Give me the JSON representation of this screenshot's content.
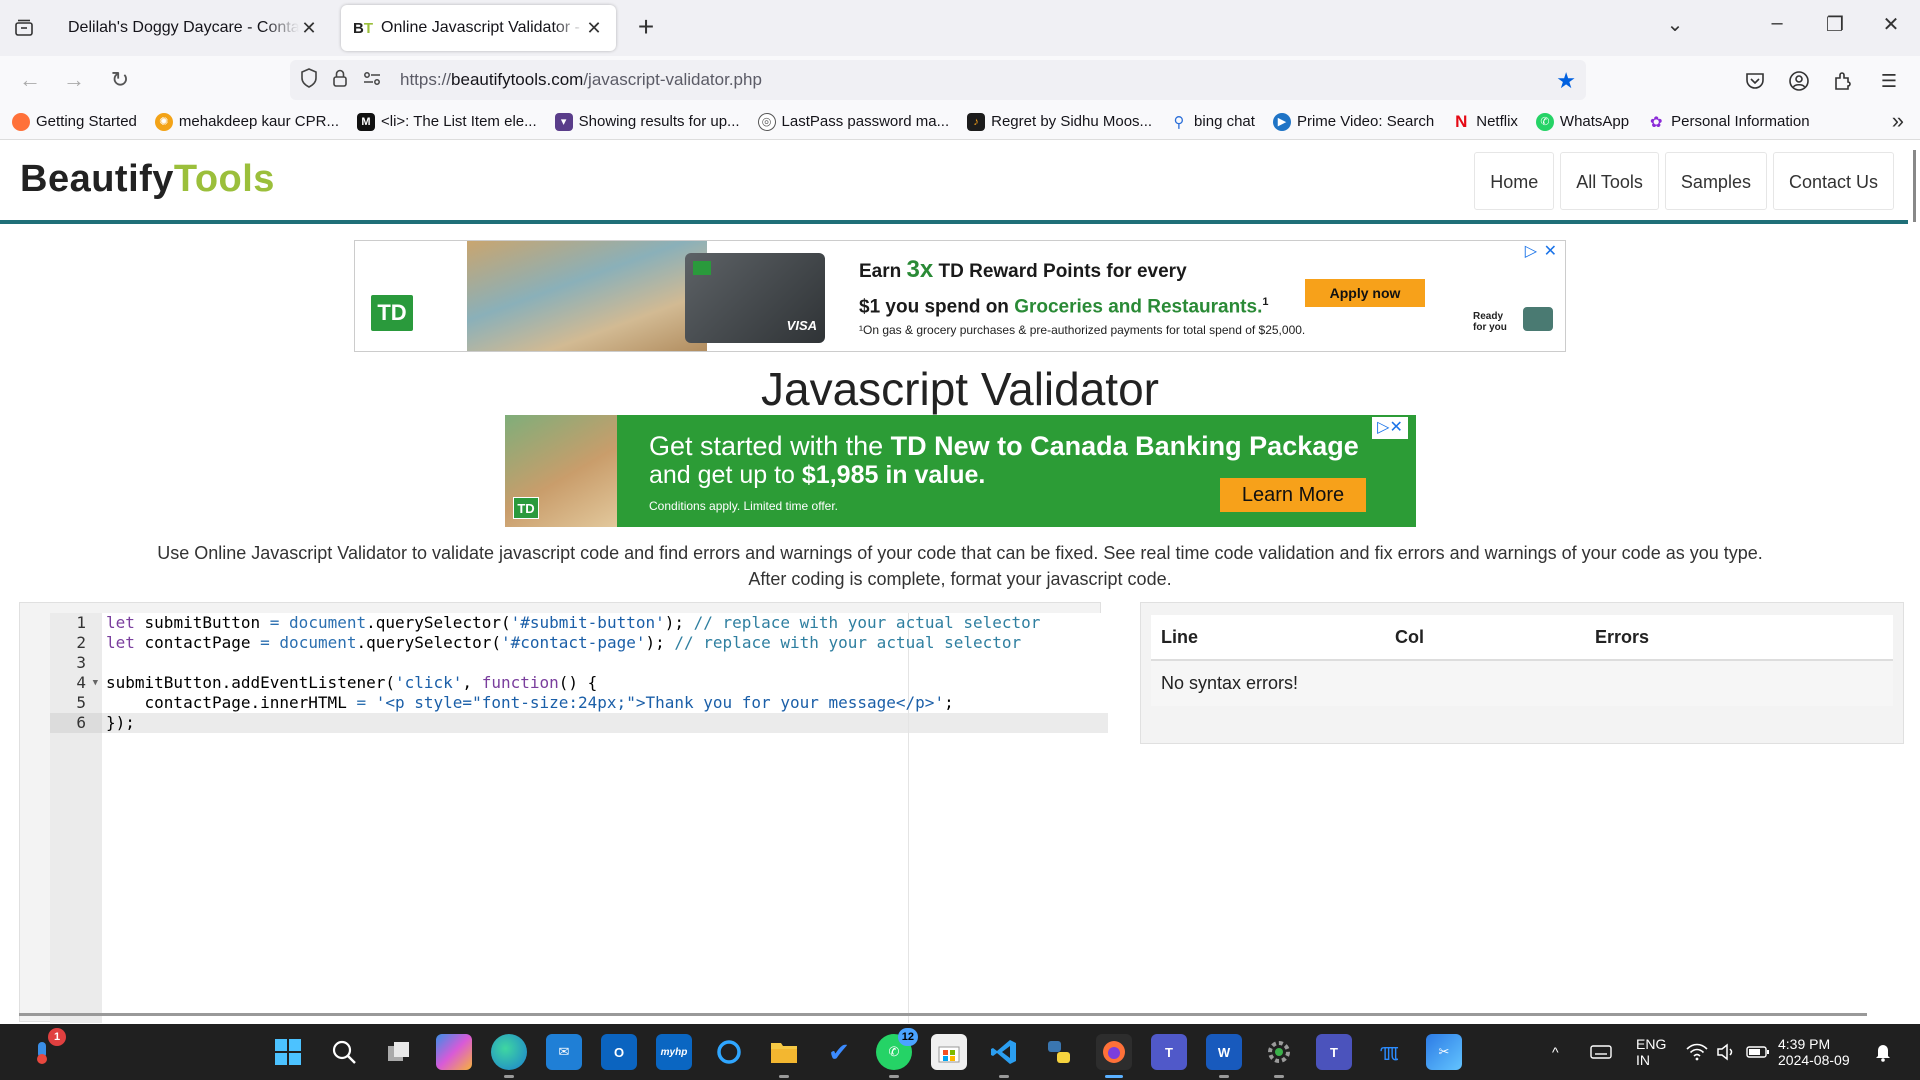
{
  "browser": {
    "tabs": [
      {
        "title": "Delilah's Doggy Daycare - Contact U",
        "active": false
      },
      {
        "title": "Online Javascript Validator - Be",
        "active": true,
        "favicon": "BT"
      }
    ],
    "url_scheme": "https://",
    "url_host": "beautifytools.com",
    "url_path": "/javascript-validator.php",
    "bookmarks": [
      {
        "label": "Getting Started",
        "icon": "firefox-icon",
        "color": "#ff7139"
      },
      {
        "label": "mehakdeep kaur CPR...",
        "icon": "radiation-icon",
        "color": "#f3a317"
      },
      {
        "label": "<li>: The List Item ele...",
        "icon": "mdn-icon",
        "color": "#111111"
      },
      {
        "label": "Showing results for up...",
        "icon": "bat-icon",
        "color": "#5a3d8a"
      },
      {
        "label": "LastPass password ma...",
        "icon": "globe-icon",
        "color": "#666666"
      },
      {
        "label": "Regret by Sidhu Moos...",
        "icon": "music-icon",
        "color": "#1c1c1c"
      },
      {
        "label": "bing chat",
        "icon": "search-icon",
        "color": "#2c6fd8"
      },
      {
        "label": "Prime Video: Search",
        "icon": "play-icon",
        "color": "#1f74c6"
      },
      {
        "label": "Netflix",
        "icon": "netflix-icon",
        "color": "#e50914"
      },
      {
        "label": "WhatsApp",
        "icon": "whatsapp-icon",
        "color": "#25d366"
      },
      {
        "label": "Personal Information",
        "icon": "gear-icon",
        "color": "#8b2bd8"
      }
    ]
  },
  "site": {
    "logo_part1": "Beautify",
    "logo_part2": "Tools",
    "nav": [
      "Home",
      "All Tools",
      "Samples",
      "Contact Us"
    ],
    "title": "Javascript Validator",
    "description_line1": "Use Online Javascript Validator to validate javascript code and find errors and warnings of your code that can be fixed. See real time code validation and fix errors and warnings of your code as you type.",
    "description_line2": "After coding is complete, format your javascript code."
  },
  "ad_top": {
    "logo": "TD",
    "headline_a": "Earn ",
    "headline_big": "3x",
    "headline_b": " TD Reward Points for every",
    "headline_c": "$1 you spend on ",
    "headline_green": "Groceries and Restaurants.",
    "headline_sup": "1",
    "fine_print": "¹On gas & grocery purchases & pre-authorized payments for total spend of $25,000.",
    "cta": "Apply now",
    "ready_line1": "Ready",
    "ready_line2": "for you",
    "card_brand": "VISA"
  },
  "ad_second": {
    "line1_a": "Get started with the ",
    "line1_b": "TD New to Canada Banking Package",
    "line2_a": "and get up to ",
    "line2_b": "$1,985 in value.",
    "fine_print": "Conditions apply. Limited time offer.",
    "cta": "Learn More",
    "logo": "TD"
  },
  "editor": {
    "line_numbers": [
      "1",
      "2",
      "3",
      "4",
      "5",
      "6"
    ],
    "active_line": 6,
    "fold_line": 4
  },
  "results": {
    "headers": [
      "Line",
      "Col",
      "Errors"
    ],
    "message": "No syntax errors!"
  },
  "taskbar": {
    "apps": [
      {
        "name": "start-icon"
      },
      {
        "name": "search-icon"
      },
      {
        "name": "task-view-icon"
      },
      {
        "name": "copilot-icon"
      },
      {
        "name": "edge-icon"
      },
      {
        "name": "mail-icon"
      },
      {
        "name": "outlook-icon"
      },
      {
        "name": "myhp-icon"
      },
      {
        "name": "cortana-icon"
      },
      {
        "name": "file-explorer-icon"
      },
      {
        "name": "todo-icon"
      },
      {
        "name": "whatsapp-icon"
      },
      {
        "name": "store-icon"
      },
      {
        "name": "vscode-icon"
      },
      {
        "name": "python-icon"
      },
      {
        "name": "firefox-icon"
      },
      {
        "name": "teams-icon"
      },
      {
        "name": "word-icon"
      },
      {
        "name": "settings-icon"
      },
      {
        "name": "teams-work-icon"
      },
      {
        "name": "hp-support-icon"
      },
      {
        "name": "snipping-tool-icon"
      }
    ],
    "whatsapp_badge": "12",
    "notification_badge": "1",
    "language_line1": "ENG",
    "language_line2": "IN",
    "time": "4:39 PM",
    "date": "2024-08-09"
  }
}
